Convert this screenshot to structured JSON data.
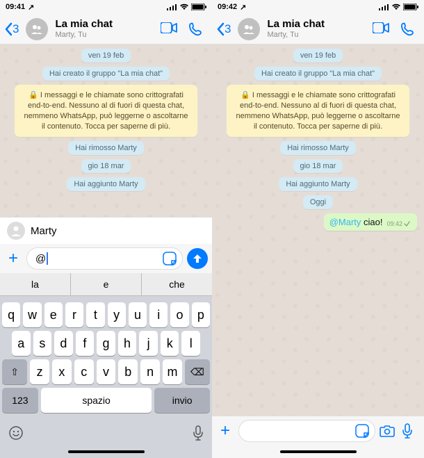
{
  "left": {
    "status": {
      "time": "09:41",
      "loc": "↗"
    },
    "header": {
      "back_count": "3",
      "title": "La mia chat",
      "subtitle": "Marty, Tu"
    },
    "messages": {
      "date1": "ven 19 feb",
      "created": "Hai creato il gruppo \"La mia chat\"",
      "encryption": "🔒 I messaggi e le chiamate sono crittografati end-to-end. Nessuno al di fuori di questa chat, nemmeno WhatsApp, può leggerne o ascoltarne il contenuto. Tocca per saperne di più.",
      "removed": "Hai rimosso Marty",
      "date2": "gio 18 mar",
      "added": "Hai aggiunto Marty"
    },
    "mention_suggestion": "Marty",
    "input_value": "@",
    "keyboard": {
      "suggestions": [
        "la",
        "e",
        "che"
      ],
      "row1": [
        "q",
        "w",
        "e",
        "r",
        "t",
        "y",
        "u",
        "i",
        "o",
        "p"
      ],
      "row2": [
        "a",
        "s",
        "d",
        "f",
        "g",
        "h",
        "j",
        "k",
        "l"
      ],
      "row3": [
        "z",
        "x",
        "c",
        "v",
        "b",
        "n",
        "m"
      ],
      "shift": "⇧",
      "backspace": "⌫",
      "numbers": "123",
      "space": "spazio",
      "return": "invio"
    }
  },
  "right": {
    "status": {
      "time": "09:42",
      "loc": "↗"
    },
    "header": {
      "back_count": "3",
      "title": "La mia chat",
      "subtitle": "Marty, Tu"
    },
    "messages": {
      "date1": "ven 19 feb",
      "created": "Hai creato il gruppo \"La mia chat\"",
      "encryption": "🔒 I messaggi e le chiamate sono crittografati end-to-end. Nessuno al di fuori di questa chat, nemmeno WhatsApp, può leggerne o ascoltarne il contenuto. Tocca per saperne di più.",
      "removed": "Hai rimosso Marty",
      "date2": "gio 18 mar",
      "added": "Hai aggiunto Marty",
      "today": "Oggi",
      "out_mention": "@Marty",
      "out_text": " ciao!",
      "out_time": "09:42"
    },
    "input_placeholder": ""
  }
}
